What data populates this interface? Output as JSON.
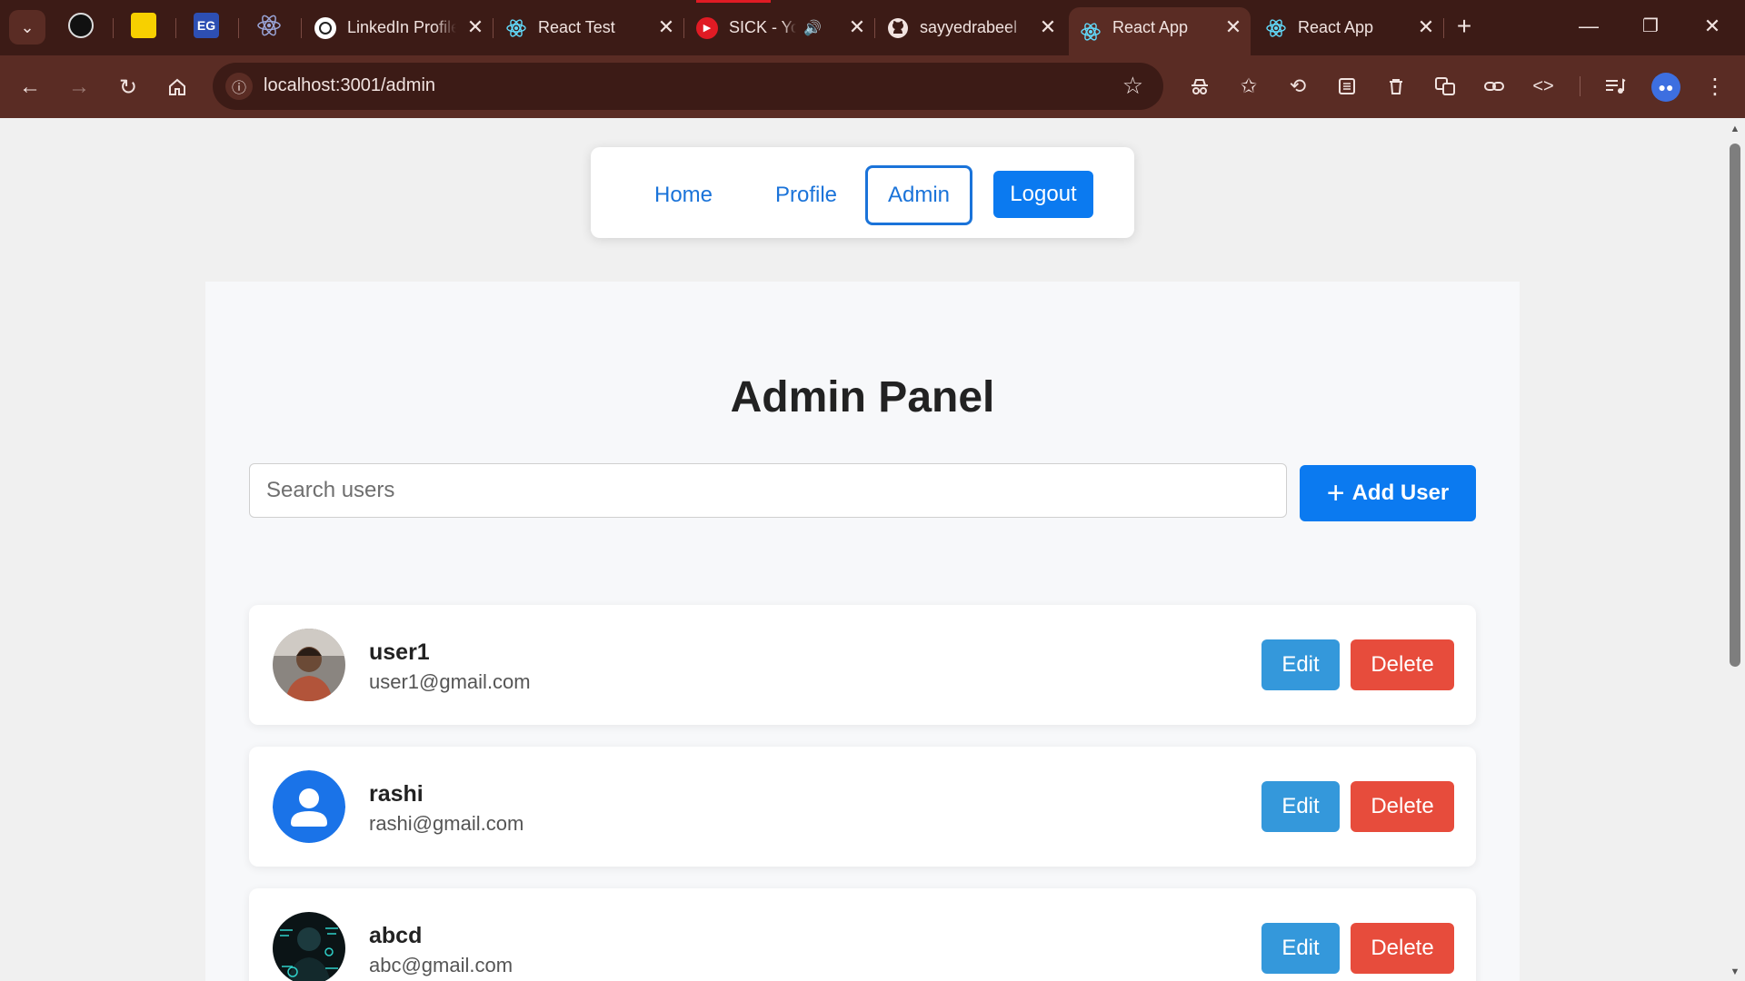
{
  "browser": {
    "tabs": [
      {
        "title": "LinkedIn Profile",
        "favicon": "linkedin-icon"
      },
      {
        "title": "React Test",
        "favicon": "react-icon"
      },
      {
        "title": "SICK - YouTube",
        "favicon": "youtube-icon"
      },
      {
        "title": "sayyedrabeel",
        "favicon": "github-icon"
      },
      {
        "title": "React App",
        "favicon": "react-icon",
        "active": true
      },
      {
        "title": "React App",
        "favicon": "react-icon"
      }
    ],
    "pinned_tabs": [
      {
        "name": "pinned-tab-1",
        "color": "#111111"
      },
      {
        "name": "pinned-tab-flipkart",
        "color": "#f7d000"
      },
      {
        "name": "pinned-tab-eg",
        "color": "#2d4fb3",
        "label": "EG"
      },
      {
        "name": "pinned-tab-react",
        "color": "#3c1b16"
      }
    ],
    "url": "localhost:3001/admin"
  },
  "nav": {
    "home": "Home",
    "profile": "Profile",
    "admin": "Admin",
    "logout": "Logout"
  },
  "admin": {
    "title": "Admin Panel",
    "search_placeholder": "Search users",
    "add_user_label": "Add User",
    "edit_label": "Edit",
    "delete_label": "Delete",
    "users": [
      {
        "name": "user1",
        "email": "user1@gmail.com",
        "avatar": "photo"
      },
      {
        "name": "rashi",
        "email": "rashi@gmail.com",
        "avatar": "default-person"
      },
      {
        "name": "abcd",
        "email": "abc@gmail.com",
        "avatar": "photo"
      }
    ]
  },
  "colors": {
    "primary": "#0b7af0",
    "edit": "#3498db",
    "delete": "#e74c3c",
    "link": "#1a73d9"
  }
}
